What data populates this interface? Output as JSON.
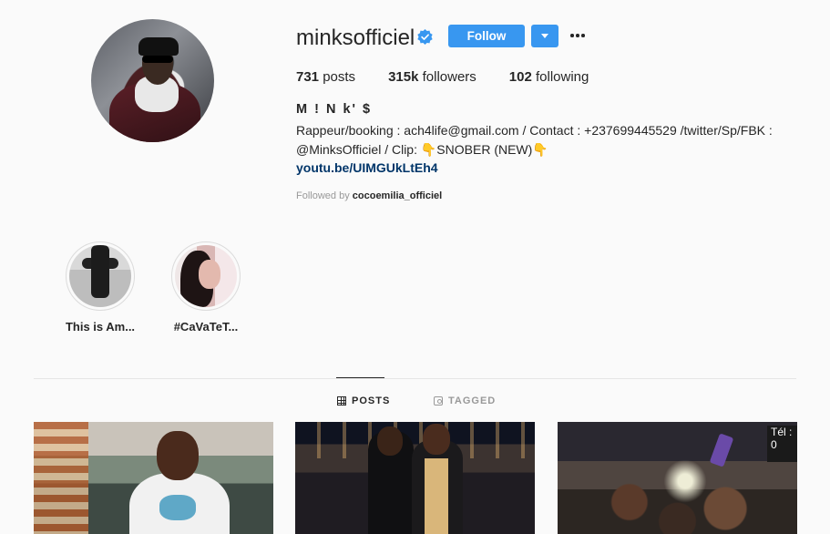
{
  "profile": {
    "username": "minksofficiel",
    "follow_label": "Follow",
    "stats": {
      "posts_count": "731",
      "posts_label": "posts",
      "followers_count": "315k",
      "followers_label": "followers",
      "following_count": "102",
      "following_label": "following"
    },
    "full_name": "M ! N k' $",
    "bio_line1": "Rappeur/booking : ach4life@gmail.com / Contact : +237699445529 /twitter/Sp/FBK :",
    "bio_line2": "@MinksOfficiel / Clip: 👇SNOBER (NEW)👇",
    "link": "youtu.be/UIMGUkLtEh4",
    "followed_by_prefix": "Followed by",
    "followed_by_user": "cocoemilia_officiel"
  },
  "highlights": [
    {
      "label": "This is Am..."
    },
    {
      "label": "#CaVaTeT..."
    }
  ],
  "tabs": [
    {
      "label": "POSTS",
      "icon": "grid-icon",
      "active": true
    },
    {
      "label": "TAGGED",
      "icon": "tag-icon",
      "active": false
    }
  ],
  "posts": [
    {
      "overlay_text": ""
    },
    {
      "overlay_text": ""
    },
    {
      "overlay_text": "Tél : 0"
    }
  ],
  "colors": {
    "accent": "#3897f0",
    "link": "#003569",
    "verified": "#3897f0"
  }
}
